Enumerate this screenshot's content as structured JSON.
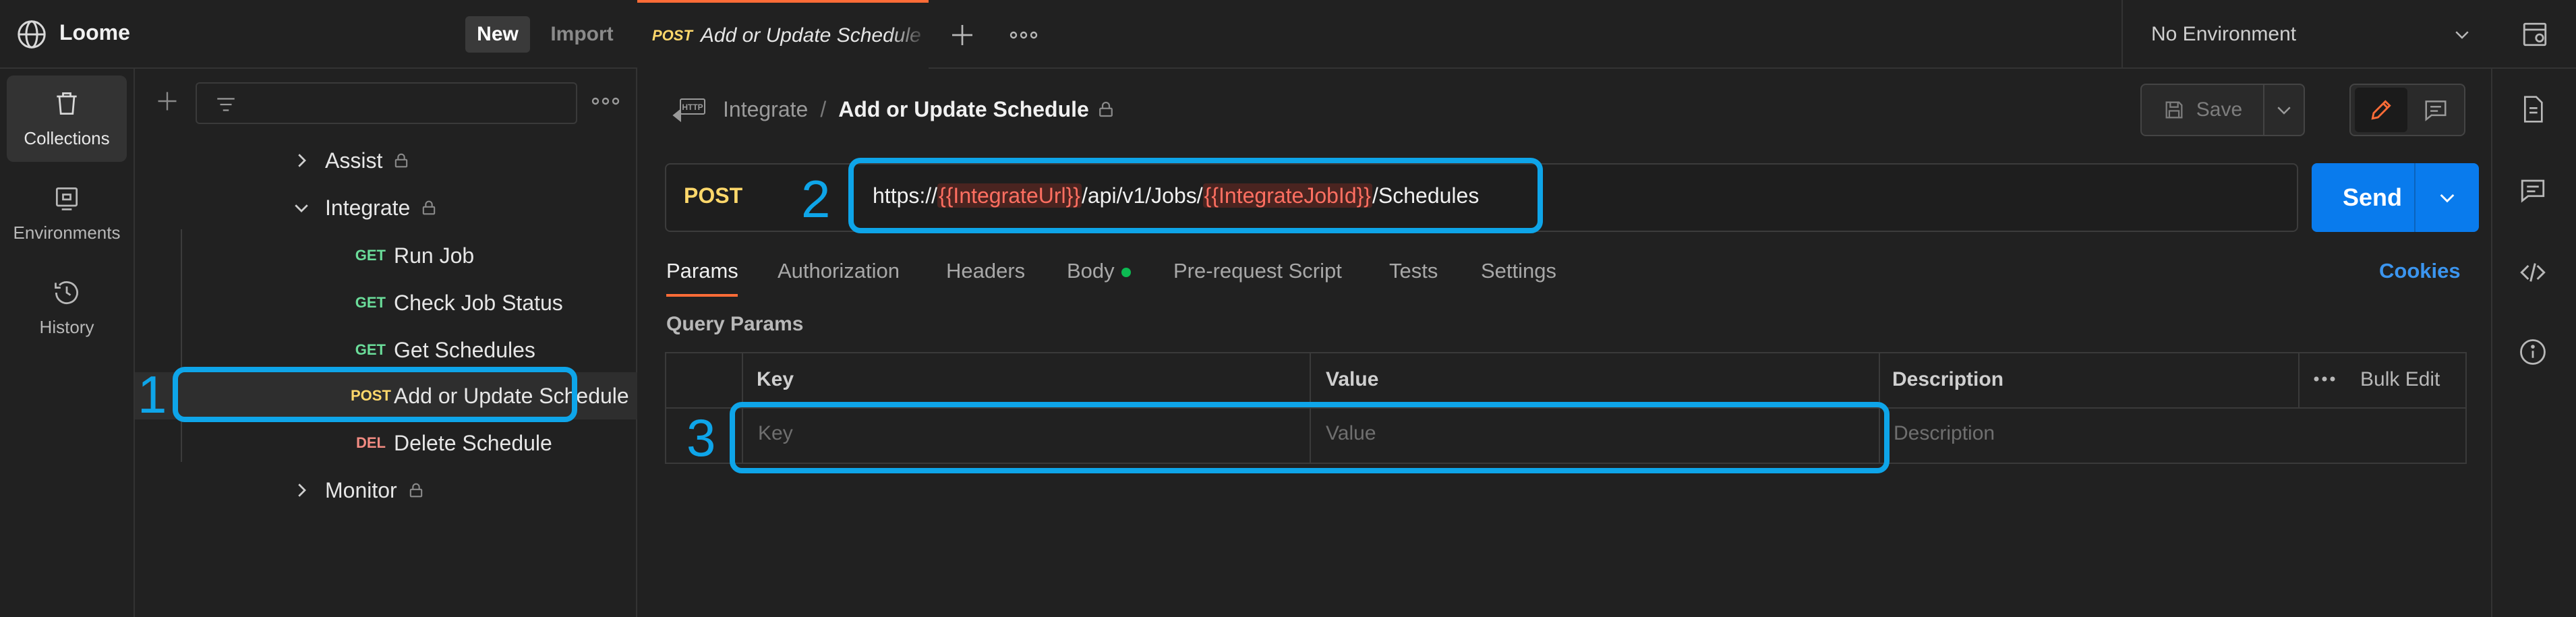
{
  "workspace": {
    "name": "Loome",
    "new_label": "New",
    "import_label": "Import"
  },
  "rail": [
    {
      "label": "Collections",
      "icon": "trash-can-icon",
      "active": true
    },
    {
      "label": "Environments",
      "icon": "environment-icon",
      "active": false
    },
    {
      "label": "History",
      "icon": "history-icon",
      "active": false
    }
  ],
  "tree": {
    "folders": [
      {
        "name": "Assist"
      },
      {
        "name": "Integrate"
      },
      {
        "name": "Monitor"
      }
    ],
    "requests": [
      {
        "method": "GET",
        "name": "Run Job"
      },
      {
        "method": "GET",
        "name": "Check Job Status"
      },
      {
        "method": "GET",
        "name": "Get Schedules"
      },
      {
        "method": "POST",
        "name": "Add or Update Schedule"
      },
      {
        "method": "DEL",
        "name": "Delete Schedule"
      }
    ]
  },
  "tabs": {
    "active": {
      "method": "POST",
      "title": "Add or Update Schedule"
    }
  },
  "environment": {
    "selected": "No Environment"
  },
  "breadcrumb": {
    "parent": "Integrate",
    "separator": "/",
    "current": "Add or Update Schedule"
  },
  "toolbar": {
    "save_label": "Save"
  },
  "request": {
    "method": "POST",
    "url_parts": {
      "prefix": "https://",
      "var1": "{{IntegrateUrl}}",
      "mid": "/api/v1/Jobs/",
      "var2": "{{IntegrateJobId}}",
      "suffix": "/Schedules"
    },
    "send_label": "Send"
  },
  "request_tabs": [
    "Params",
    "Authorization",
    "Headers",
    "Body",
    "Pre-request Script",
    "Tests",
    "Settings"
  ],
  "cookies_label": "Cookies",
  "params": {
    "title": "Query Params",
    "headers": {
      "key": "Key",
      "value": "Value",
      "description": "Description"
    },
    "bulk_edit_label": "Bulk Edit",
    "placeholders": {
      "key": "Key",
      "value": "Value",
      "description": "Description"
    }
  },
  "callouts": {
    "one": "1",
    "two": "2",
    "three": "3"
  },
  "colors": {
    "accent": "#ff6c37",
    "send": "#097bed",
    "callout": "#0ea5e9",
    "post": "#ffd86b",
    "get": "#6bdd9a",
    "del": "#f28b82"
  }
}
